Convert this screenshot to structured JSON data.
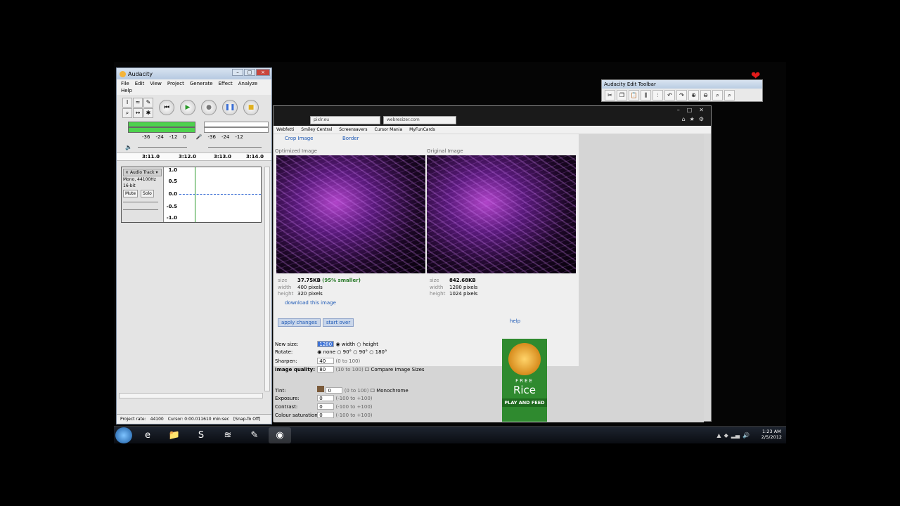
{
  "audacity": {
    "title": "Audacity",
    "menu": [
      "File",
      "Edit",
      "View",
      "Project",
      "Generate",
      "Effect",
      "Analyze"
    ],
    "menu_row2": "Help",
    "meter_scale": [
      "-36",
      "-24",
      "-12",
      "0"
    ],
    "meter_scale2": [
      "-36",
      "-24",
      "-12"
    ],
    "ruler": [
      "3:11.0",
      "3:12.0",
      "3:13.0",
      "3:14.0"
    ],
    "track_name": "Audio Track",
    "track_info1": "Mono, 44100Hz",
    "track_info2": "16-bit",
    "mute": "Mute",
    "solo": "Solo",
    "vscale": [
      "1.0",
      "0.5",
      "0.0",
      "-0.5",
      "-1.0"
    ],
    "project_rate_label": "Project rate:",
    "project_rate": "44100",
    "cursor": "Cursor: 0:00.011610 min:sec",
    "snap": "[Snap-To Off]"
  },
  "browser": {
    "tabs": [
      "webresizer.com"
    ],
    "tab_left": "pixlr.eu",
    "bookmarks": [
      "Webfetti",
      "Smiley Central",
      "Screensavers",
      "Cursor Mania",
      "MyFunCards"
    ],
    "crop_link": "Crop Image",
    "border_link": "Border",
    "optimized_label": "Optimized Image",
    "original_label": "Original Image",
    "opt_info": {
      "size": "37.75KB",
      "smaller": "(95% smaller)",
      "width": "400 pixels",
      "height": "320 pixels"
    },
    "orig_info": {
      "size": "842.68KB",
      "width": "1280 pixels",
      "height": "1024 pixels"
    },
    "info_labels": {
      "size": "size",
      "width": "width",
      "height": "height"
    },
    "download": "download this image",
    "apply": "apply changes",
    "start_over": "start over",
    "help": "help",
    "form": {
      "new_size_label": "New size:",
      "new_size_value": "1280",
      "width_opt": "width",
      "height_opt": "height",
      "rotate_label": "Rotate:",
      "rotate_opts": [
        "none",
        "90°",
        "90°",
        "180°"
      ],
      "sharpen_label": "Sharpen:",
      "sharpen_value": "40",
      "sharpen_hint": "(0 to 100)",
      "quality_label": "Image quality:",
      "quality_value": "80",
      "quality_hint": "(10 to 100)",
      "compare": "Compare Image Sizes",
      "tint_label": "Tint:",
      "tint_value": "0",
      "tint_hint": "(0 to 100)",
      "monochrome": "Monochrome",
      "exposure_label": "Exposure:",
      "exposure_value": "0",
      "exposure_hint": "(-100 to +100)",
      "contrast_label": "Contrast:",
      "contrast_value": "0",
      "contrast_hint": "(-100 to +100)",
      "saturation_label": "Colour saturation:",
      "saturation_value": "0",
      "saturation_hint": "(-100 to +100)"
    },
    "ad": {
      "free": "FREE",
      "word": "Rice",
      "feed": "PLAY AND FEED"
    }
  },
  "edit_toolbar": {
    "title": "Audacity Edit Toolbar"
  },
  "taskbar": {
    "time": "1:23 AM",
    "date": "2/5/2012"
  },
  "colors": {
    "accent": "#3b72d8",
    "meter": "#4dd24d",
    "ad_green": "#2f8a2f"
  }
}
